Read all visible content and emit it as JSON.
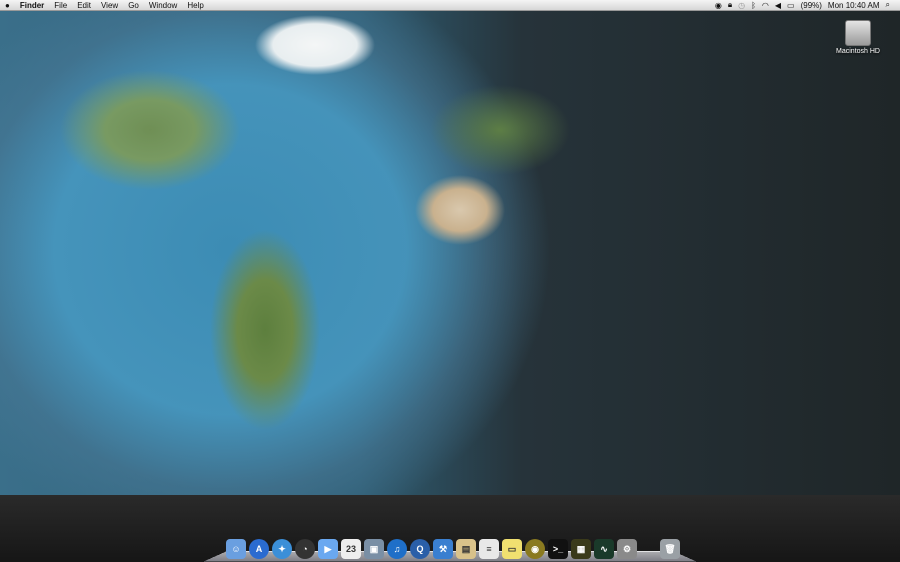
{
  "menubar": {
    "apple": "",
    "items": [
      "Finder",
      "File",
      "Edit",
      "View",
      "Go",
      "Window",
      "Help"
    ],
    "status": {
      "battery": "(99%)",
      "clock": "Mon 10:40 AM"
    }
  },
  "desktop": {
    "hd_label": "Macintosh HD"
  },
  "dock": {
    "items": [
      {
        "name": "finder",
        "label": "☺",
        "color": "#6a9fe0"
      },
      {
        "name": "app-store",
        "label": "A",
        "color": "#2a6bd0"
      },
      {
        "name": "safari",
        "label": "✦",
        "color": "#3b8fd8"
      },
      {
        "name": "dashboard",
        "label": "◔",
        "color": "#333"
      },
      {
        "name": "ichat",
        "label": "▶",
        "color": "#6aa8f0"
      },
      {
        "name": "ical",
        "label": "23",
        "color": "#eee"
      },
      {
        "name": "iphoto",
        "label": "▣",
        "color": "#7a8fa5"
      },
      {
        "name": "itunes",
        "label": "♫",
        "color": "#1f6fc8"
      },
      {
        "name": "quicktime",
        "label": "Q",
        "color": "#2a5fa8"
      },
      {
        "name": "xcode",
        "label": "⚒",
        "color": "#3a7fd0"
      },
      {
        "name": "archive-utility",
        "label": "▤",
        "color": "#d9c28a"
      },
      {
        "name": "textedit",
        "label": "≡",
        "color": "#e8e8e8"
      },
      {
        "name": "stickies",
        "label": "▭",
        "color": "#f0e070"
      },
      {
        "name": "network-radar",
        "label": "◉",
        "color": "#8a7a20"
      },
      {
        "name": "terminal",
        "label": ">_",
        "color": "#111"
      },
      {
        "name": "console",
        "label": "▦",
        "color": "#3a3a1a"
      },
      {
        "name": "activity-monitor",
        "label": "∿",
        "color": "#1a3a2a"
      },
      {
        "name": "system-preferences",
        "label": "⚙",
        "color": "#8a8a8a"
      },
      {
        "name": "trash",
        "label": "🗑",
        "color": "#9aa0a5"
      }
    ]
  }
}
